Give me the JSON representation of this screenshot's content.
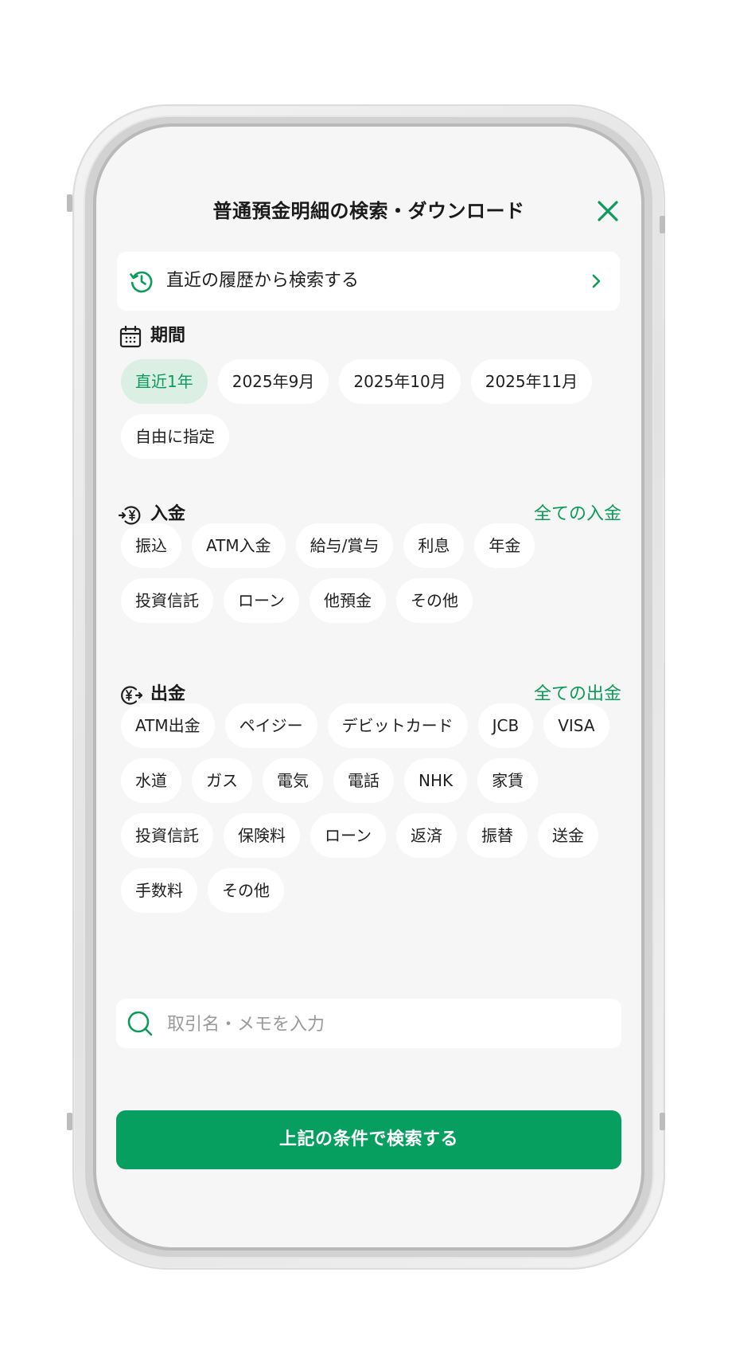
{
  "header": {
    "title": "普通預金明細の検索・ダウンロード"
  },
  "history": {
    "label": "直近の履歴から検索する"
  },
  "period": {
    "label": "期間",
    "chips": [
      "直近1年",
      "2025年9月",
      "2025年10月",
      "2025年11月",
      "自由に指定"
    ],
    "selected_index": 0
  },
  "deposit": {
    "label": "入金",
    "all_link": "全ての入金",
    "chips": [
      "振込",
      "ATM入金",
      "給与/賞与",
      "利息",
      "年金",
      "投資信託",
      "ローン",
      "他預金",
      "その他"
    ]
  },
  "withdrawal": {
    "label": "出金",
    "all_link": "全ての出金",
    "chips": [
      "ATM出金",
      "ペイジー",
      "デビットカード",
      "JCB",
      "VISA",
      "水道",
      "ガス",
      "電気",
      "電話",
      "NHK",
      "家賃",
      "投資信託",
      "保険料",
      "ローン",
      "返済",
      "振替",
      "送金",
      "手数料",
      "その他"
    ]
  },
  "search": {
    "placeholder": "取引名・メモを入力",
    "value": ""
  },
  "submit": {
    "label": "上記の条件で検索する"
  },
  "colors": {
    "accent": "#079f5f",
    "selected_chip_bg": "#dcefe5",
    "screen_bg": "#f6f6f6"
  },
  "icons": {
    "close": "close-icon",
    "history": "history-icon",
    "history_chevron": "chevron-right-icon",
    "period": "calendar-icon",
    "deposit": "yen-in-icon",
    "withdrawal": "yen-out-icon",
    "search": "search-icon"
  }
}
